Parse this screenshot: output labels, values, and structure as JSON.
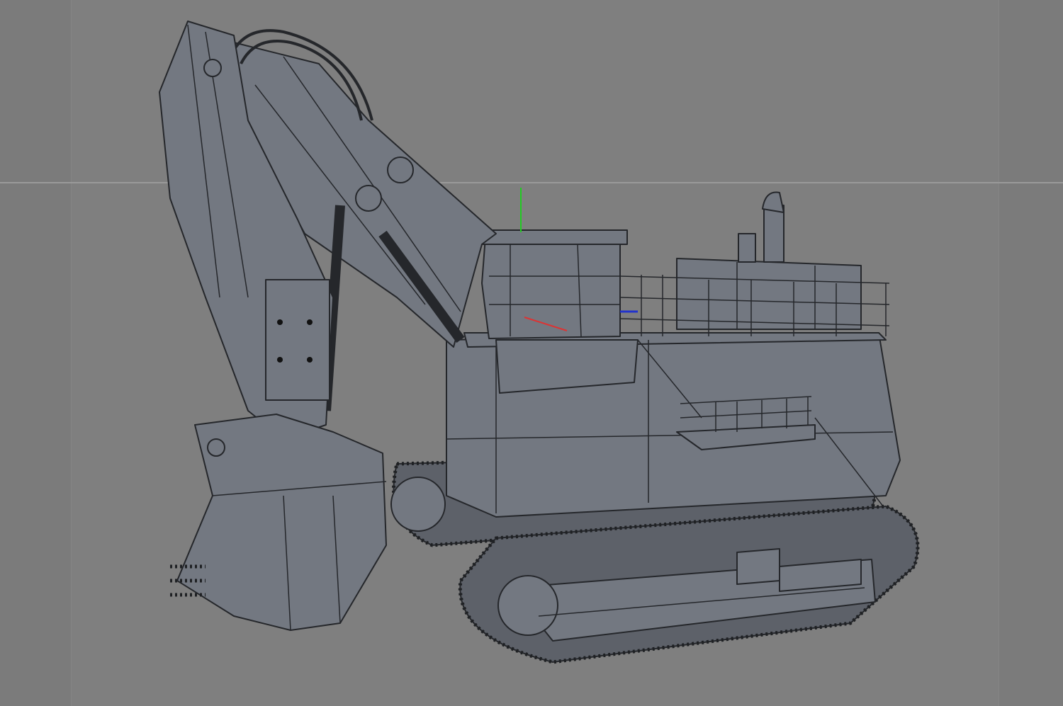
{
  "viewport": {
    "background": "#7f7f7f",
    "model_fill": "#737881",
    "edge_color": "#25272b",
    "axis_colors": {
      "y": "#22cc22",
      "x": "#dd3333",
      "z": "#2233cc"
    }
  }
}
